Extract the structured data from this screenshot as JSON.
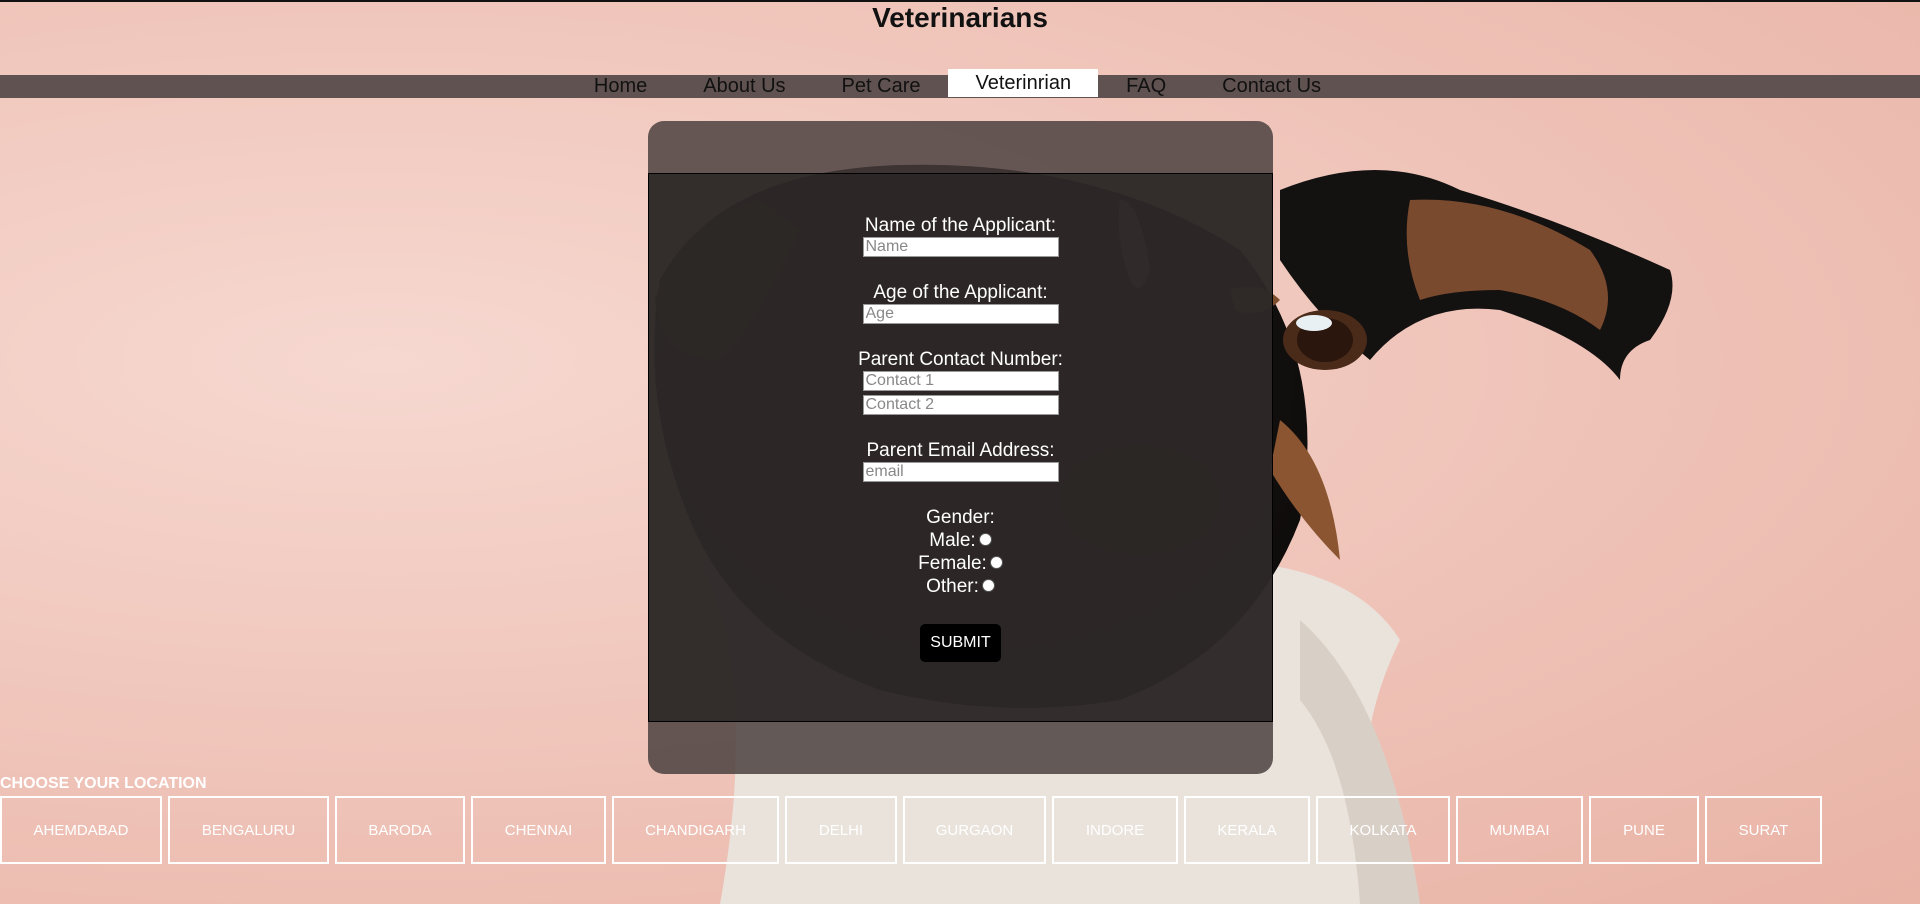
{
  "header": {
    "title": "Veterinarians"
  },
  "nav": {
    "items": [
      {
        "label": "Home"
      },
      {
        "label": "About Us"
      },
      {
        "label": "Pet Care"
      },
      {
        "label": "Veterinrian"
      },
      {
        "label": "FAQ"
      },
      {
        "label": "Contact Us"
      }
    ],
    "active": "Veterinrian"
  },
  "form": {
    "name_label": "Name of the Applicant:",
    "name_placeholder": "Name",
    "age_label": "Age of the Applicant:",
    "age_placeholder": "Age",
    "contact_label": "Parent Contact Number:",
    "contact1_placeholder": "Contact 1",
    "contact2_placeholder": "Contact 2",
    "email_label": "Parent Email Address:",
    "email_placeholder": "email",
    "gender_label": "Gender:",
    "gender_options": [
      {
        "label": "Male:"
      },
      {
        "label": "Female:"
      },
      {
        "label": "Other:"
      }
    ],
    "submit_label": "SUBMIT"
  },
  "locations": {
    "heading": "CHOOSE YOUR LOCATION",
    "items": [
      {
        "label": "AHEMDABAD"
      },
      {
        "label": "BENGALURU"
      },
      {
        "label": "BARODA"
      },
      {
        "label": "CHENNAI"
      },
      {
        "label": "CHANDIGARH"
      },
      {
        "label": "DELHI"
      },
      {
        "label": "GURGAON"
      },
      {
        "label": "INDORE"
      },
      {
        "label": "KERALA"
      },
      {
        "label": "KOLKATA"
      },
      {
        "label": "MUMBAI"
      },
      {
        "label": "PUNE"
      },
      {
        "label": "SURAT"
      }
    ]
  },
  "colors": {
    "background": "#efc3b8",
    "navbar": "#5f5250",
    "form_panel": "#2a2423"
  }
}
